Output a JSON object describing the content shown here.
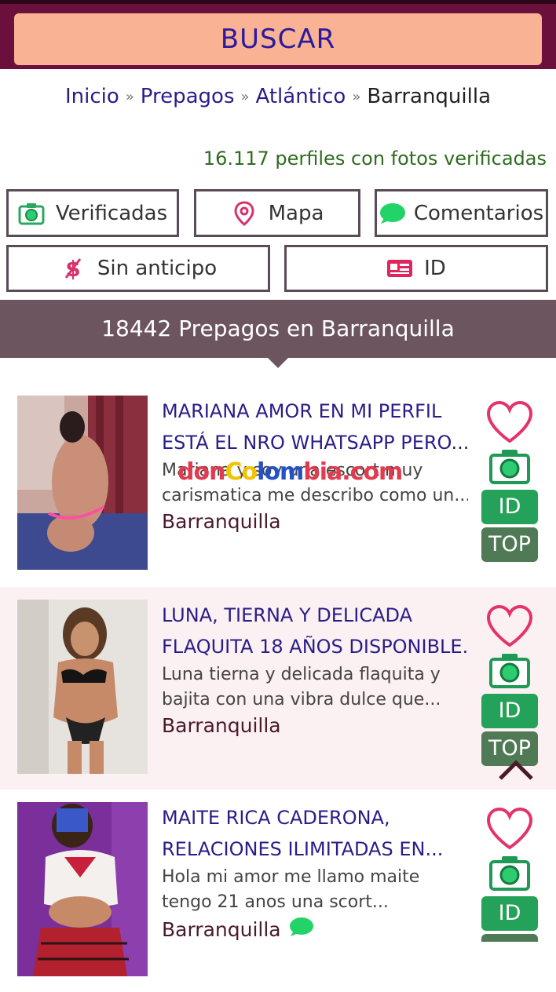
{
  "header": {
    "search_label": "BUSCAR"
  },
  "breadcrumb": {
    "items": [
      "Inicio",
      "Prepagos",
      "Atlántico"
    ],
    "sep": "»",
    "current": "Barranquilla"
  },
  "verified_count": "16.117 perfiles con fotos verificadas",
  "filters": {
    "verificadas": "Verificadas",
    "mapa": "Mapa",
    "comentarios": "Comentarios",
    "sin_anticipo": "Sin anticipo",
    "id": "ID"
  },
  "band": {
    "title": "18442 Prepagos en Barranquilla"
  },
  "watermark": {
    "parts": [
      "don",
      "Co",
      "lom",
      "bia",
      ".com"
    ]
  },
  "listings": [
    {
      "title1": "MARIANA AMOR EN MI PERFIL",
      "title2": "ESTÁ EL NRO WHATSAPP PERO...",
      "desc1": "Mariana y soy una escort muy",
      "desc2": "carismatica me describo como un...",
      "city": "Barranquilla",
      "badge_id": "ID",
      "badge_top": "TOP"
    },
    {
      "title1": "LUNA, TIERNA Y DELICADA",
      "title2": "FLAQUITA 18 AÑOS DISPONIBLE...",
      "desc1": "Luna tierna y delicada flaquita y",
      "desc2": "bajita con una vibra dulce que...",
      "city": "Barranquilla",
      "badge_id": "ID",
      "badge_top": "TOP"
    },
    {
      "title1": "MAITE RICA CADERONA,",
      "title2": "RELACIONES ILIMITADAS EN...",
      "desc1": "Hola mi amor me llamo maite",
      "desc2": "tengo 21 anos una scort...",
      "city": "Barranquilla",
      "badge_id": "ID"
    }
  ],
  "colors": {
    "accent": "#6b0f3c",
    "search_bg": "#f9b394",
    "link": "#2a1d88",
    "verified_green": "#2e6b1f",
    "band": "#6d5560",
    "badge_id": "#25a25a",
    "badge_top": "#4f7a55"
  },
  "icons": [
    "camera-icon",
    "map-pin-icon",
    "chat-bubble-icon",
    "dollar-slash-icon",
    "id-card-icon",
    "heart-icon",
    "chevron-up-icon"
  ]
}
